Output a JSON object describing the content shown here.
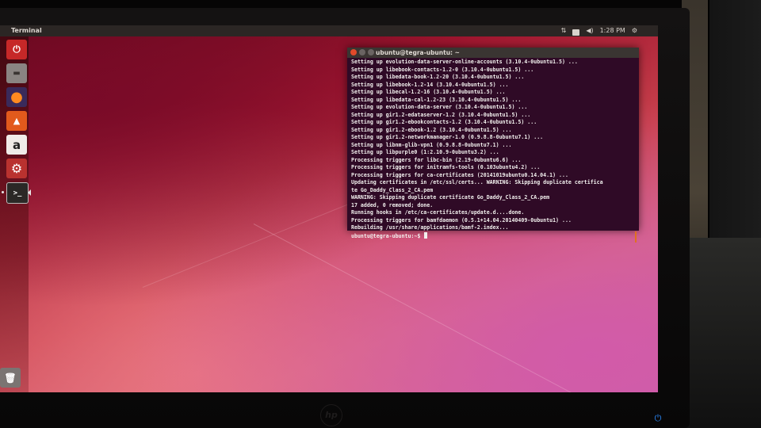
{
  "panel": {
    "app_title": "Terminal",
    "time": "1:28 PM"
  },
  "launcher": {
    "items": [
      {
        "name": "dash-home",
        "glyph": "⏻",
        "color": "#c62828"
      },
      {
        "name": "files",
        "glyph": "▬",
        "color": "#8a8482"
      },
      {
        "name": "firefox",
        "glyph": "●",
        "color": "#e8671c"
      },
      {
        "name": "software-center",
        "glyph": "▲",
        "color": "#e25a1c"
      },
      {
        "name": "amazon",
        "glyph": "a",
        "color": "#f0ece8"
      },
      {
        "name": "system-settings",
        "glyph": "⚙",
        "color": "#b9322f"
      },
      {
        "name": "terminal",
        "glyph": ">_",
        "color": "#2b2826"
      },
      {
        "name": "trash",
        "glyph": "🗑",
        "color": "#7a7472"
      }
    ]
  },
  "terminal": {
    "title": "ubuntu@tegra-ubuntu: ~",
    "lines": [
      "Setting up evolution-data-server-online-accounts (3.10.4-0ubuntu1.5) ...",
      "Setting up libebook-contacts-1.2-0 (3.10.4-0ubuntu1.5) ...",
      "Setting up libedata-book-1.2-20 (3.10.4-0ubuntu1.5) ...",
      "Setting up libebook-1.2-14 (3.10.4-0ubuntu1.5) ...",
      "Setting up libecal-1.2-16 (3.10.4-0ubuntu1.5) ...",
      "Setting up libedata-cal-1.2-23 (3.10.4-0ubuntu1.5) ...",
      "Setting up evolution-data-server (3.10.4-0ubuntu1.5) ...",
      "Setting up gir1.2-edataserver-1.2 (3.10.4-0ubuntu1.5) ...",
      "Setting up gir1.2-ebookcontacts-1.2 (3.10.4-0ubuntu1.5) ...",
      "Setting up gir1.2-ebook-1.2 (3.10.4-0ubuntu1.5) ...",
      "Setting up gir1.2-networkmanager-1.0 (0.9.8.8-0ubuntu7.1) ...",
      "Setting up libnm-glib-vpn1 (0.9.8.8-0ubuntu7.1) ...",
      "Setting up libpurple0 (1:2.10.9-0ubuntu3.2) ...",
      "Processing triggers for libc-bin (2.19-0ubuntu6.6) ...",
      "Processing triggers for initramfs-tools (0.103ubuntu4.2) ...",
      "Processing triggers for ca-certificates (20141019ubuntu0.14.04.1) ...",
      "Updating certificates in /etc/ssl/certs... WARNING: Skipping duplicate certifica",
      "te Go_Daddy_Class_2_CA.pem",
      "WARNING: Skipping duplicate certificate Go_Daddy_Class_2_CA.pem",
      "17 added, 0 removed; done.",
      "Running hooks in /etc/ca-certificates/update.d....done.",
      "Processing triggers for bamfdaemon (0.5.1+14.04.20140409-0ubuntu1) ...",
      "Rebuilding /usr/share/applications/bamf-2.index...",
      "ubuntu@tegra-ubuntu:~$ "
    ]
  },
  "monitor": {
    "brand": "hp"
  }
}
